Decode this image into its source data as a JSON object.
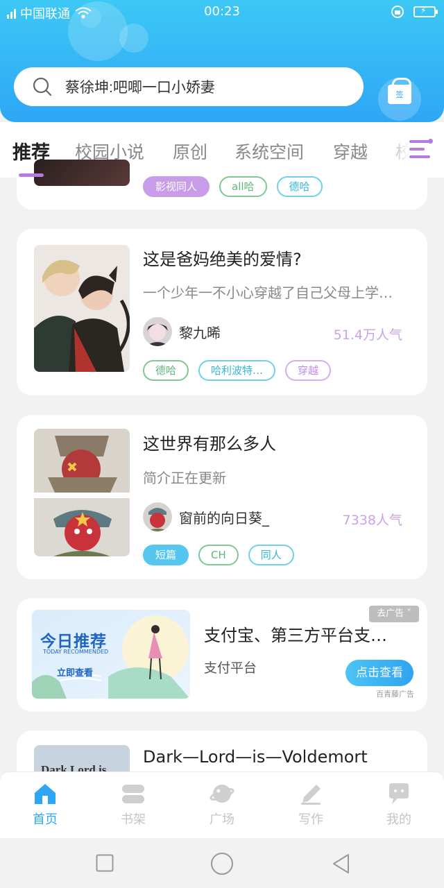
{
  "status_bar": {
    "carrier": "中国联通",
    "time": "00:23"
  },
  "search": {
    "placeholder_text": "蔡徐坤:吧唧一口小娇妻"
  },
  "gift": {
    "label": "签"
  },
  "tabs": [
    {
      "label": "推荐"
    },
    {
      "label": "校园小说"
    },
    {
      "label": "原创"
    },
    {
      "label": "系统空间"
    },
    {
      "label": "穿越"
    },
    {
      "label": "校"
    }
  ],
  "cards": [
    {
      "tags": [
        "影视同人",
        "all哈",
        "德哈"
      ]
    },
    {
      "title": "这是爸妈绝美的爱情?",
      "desc": "一个少年一不小心穿越了自己父母上学…",
      "author": "黎九晞",
      "popularity": "51.4万人气",
      "tags": [
        "德哈",
        "哈利波特…",
        "穿越"
      ]
    },
    {
      "title": "这世界有那么多人",
      "desc": "简介正在更新",
      "author": "窗前的向日葵_",
      "popularity": "7338人气",
      "tags": [
        "短篇",
        "CH",
        "同人"
      ]
    },
    {
      "title": "Dark—Lord—is—Voldemort",
      "cover_text": "Dark Lord is"
    }
  ],
  "ad": {
    "title": "支付宝、第三方平台支…",
    "subtitle": "支付平台",
    "button": "点击查看",
    "badge": "去广告",
    "source": "百青藤广告",
    "image_title": "今日推荐",
    "image_subtitle": "TODAY RECOMMENDED",
    "image_cta": "立即查看"
  },
  "bottom_nav": [
    {
      "label": "首页",
      "active": true
    },
    {
      "label": "书架"
    },
    {
      "label": "广场"
    },
    {
      "label": "写作"
    },
    {
      "label": "我的"
    }
  ],
  "colors": {
    "brand_blue": "#2ea6f6",
    "accent_purple": "#b57be0",
    "popularity": "#c9a3ea"
  }
}
